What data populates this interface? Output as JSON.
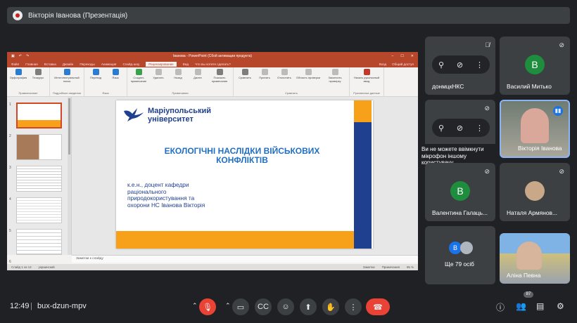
{
  "header": {
    "title": "Вікторія Іванова (Презентація)"
  },
  "ppt": {
    "window_title": "Іванова - PowerPoint (Сбой активации продукта)",
    "tabs": [
      "Файл",
      "Главная",
      "Вставка",
      "Дизайн",
      "Переходы",
      "Анимация",
      "Слайд-шоу",
      "Рецензирование",
      "Вид"
    ],
    "active_tab": "Рецензирование",
    "tell_me": "Что вы хотите сделать?",
    "sign_in": "Вход",
    "share": "Общий доступ",
    "ribbon_groups": [
      {
        "label": "Правописание",
        "buttons": [
          "Орфография",
          "Тезаурус"
        ]
      },
      {
        "label": "Подробные сведения",
        "buttons": [
          "Интеллектуальный поиск"
        ]
      },
      {
        "label": "Язык",
        "buttons": [
          "Перевод",
          "Язык"
        ]
      },
      {
        "label": "Примечания",
        "buttons": [
          "Создать примечание",
          "Удалить",
          "Назад",
          "Далее",
          "Показать примечания"
        ]
      },
      {
        "label": "Сравнить",
        "buttons": [
          "Сравнить",
          "Принять",
          "Отклонить",
          "Назад",
          "Далее",
          "Область проверки",
          "Закончить проверку"
        ]
      },
      {
        "label": "Рукописные данные",
        "buttons": [
          "Начать рукописный ввод"
        ]
      }
    ],
    "thumbnails": [
      "1",
      "2",
      "3",
      "4",
      "5",
      "6"
    ],
    "slide": {
      "logo_line1": "Маріупольський",
      "logo_line2": "університет",
      "title": "ЕКОЛОГІЧНІ НАСЛІДКИ ВІЙСЬКОВИХ КОНФЛІКТІВ",
      "body": "к.е.н., доцент кафедри раціонального природокористування та охорони НС Іванова Вікторія"
    },
    "notes": "Заметки к слайду",
    "status": {
      "slide": "Слайд 1 из 14",
      "lang": "украинский",
      "notes": "Заметки",
      "comments": "Примечания",
      "zoom": "65 %"
    }
  },
  "participants": [
    {
      "name": "донмцкНКС",
      "avatar": "",
      "color": "",
      "muted": true
    },
    {
      "name": "Василий Митько",
      "avatar": "В",
      "color": "#1e8e3e",
      "muted": true
    },
    {
      "name": "Вікторія Іванова",
      "avatar": "",
      "color": "",
      "muted": false
    },
    {
      "name": "Валентина Галаць...",
      "avatar": "В",
      "color": "#1e8e3e",
      "muted": true
    },
    {
      "name": "Наталя Армянов...",
      "avatar": "",
      "color": "",
      "muted": true
    },
    {
      "name": "Ще 79 осіб",
      "avatar": "В",
      "color": "#1a73e8",
      "muted": false
    },
    {
      "name": "Аліна Певна",
      "avatar": "",
      "color": "",
      "muted": false
    }
  ],
  "tooltip": "Ви не можете ввімкнути мікрофон іншому користувачу",
  "controls": {
    "time": "12:49",
    "meeting_code": "bux-dzun-mpv",
    "people_count": "87",
    "colors": {
      "end_call": "#ea4335",
      "mic_off": "#ea4335",
      "bg": "#202124",
      "tile": "#3c4043"
    }
  }
}
